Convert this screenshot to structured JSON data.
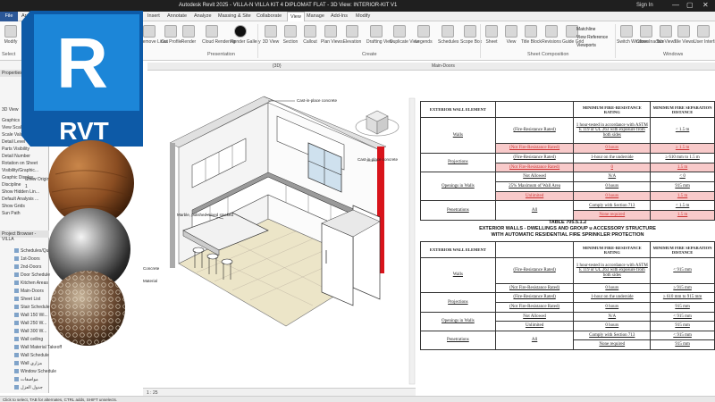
{
  "window": {
    "title": "Autodesk Revit 2025 - VILLA-N VILLA KIT 4 DIPLOMAT FLAT - 3D View: INTERIOR-KIT V1",
    "sign_in": "Sign In",
    "controls": [
      "—",
      "▢",
      "✕"
    ]
  },
  "menu": {
    "tabs": [
      "File",
      "Archi",
      "",
      "",
      "",
      "Insert",
      "Annotate",
      "Analyze",
      "Massing & Site",
      "Collaborate",
      "View",
      "Manage",
      "Add-Ins",
      "Modify"
    ],
    "active": "View"
  },
  "ribbon": {
    "buttons": [
      {
        "label": "Modify",
        "icon": "cursor-icon"
      },
      {
        "label": "Remove Lines",
        "icon": "remove-lines-icon"
      },
      {
        "label": "Cut Profile",
        "icon": "cut-profile-icon"
      },
      {
        "label": "Render",
        "icon": "teapot-icon"
      },
      {
        "label": "Cloud Rendering",
        "icon": "cloud-icon"
      },
      {
        "label": "Render Gallery",
        "icon": "gallery-icon"
      },
      {
        "label": "3D View",
        "icon": "cube-icon"
      },
      {
        "label": "Section",
        "icon": "section-icon"
      },
      {
        "label": "Callout",
        "icon": "callout-icon"
      },
      {
        "label": "Plan Views",
        "icon": "plan-icon"
      },
      {
        "label": "Elevation",
        "icon": "elevation-icon"
      },
      {
        "label": "Drafting View",
        "icon": "drafting-icon"
      },
      {
        "label": "Duplicate View",
        "icon": "duplicate-icon"
      },
      {
        "label": "Legends",
        "icon": "legend-icon"
      },
      {
        "label": "Schedules",
        "icon": "schedule-icon"
      },
      {
        "label": "Scope Box",
        "icon": "scope-icon"
      },
      {
        "label": "Sheet",
        "icon": "sheet-icon"
      },
      {
        "label": "View",
        "icon": "view-icon"
      },
      {
        "label": "Title Block",
        "icon": "titleblock-icon"
      },
      {
        "label": "Revisions",
        "icon": "revisions-icon"
      },
      {
        "label": "Guide Grid",
        "icon": "grid-icon"
      },
      {
        "label": "Switch Windows",
        "icon": "switch-icon"
      },
      {
        "label": "Close Inactive",
        "icon": "close-inactive-icon"
      },
      {
        "label": "Tab Views",
        "icon": "tab-icon"
      },
      {
        "label": "Tile Views",
        "icon": "tile-icon"
      },
      {
        "label": "User Interface",
        "icon": "ui-icon"
      }
    ],
    "groups": [
      "Select",
      "Presentation",
      "Create",
      "Sheet Composition",
      "Windows"
    ],
    "matchline": "Matchline",
    "view_reference": "View Reference",
    "viewports": "Viewports"
  },
  "doc_tabs": [
    "{3D}",
    "Main-Doors"
  ],
  "left_panel": {
    "properties_title": "Properties",
    "view_label": "3D View",
    "rows": [
      "Graphics",
      "View Scale",
      "Scale Value",
      "Detail Level",
      "Parts Visibility",
      "Detail Number",
      "Rotation on Sheet",
      "Visibility/Graphic...",
      "Graphic Display...",
      "Discipline",
      "Show Hidden Lin...",
      "Default Analysis ...",
      "Show Grids",
      "Sun Path",
      "Extents"
    ],
    "values": [
      "",
      "",
      "",
      "",
      "Show Origin",
      "1",
      "",
      "",
      "",
      "",
      "",
      "",
      "",
      "",
      ""
    ],
    "browser_title": "Project Browser - VILLA",
    "browser_items": [
      "Schedules/Quan...",
      "1st-Doors",
      "2nd-Doors",
      "Door Schedule",
      "Kitchen Areas",
      "Main-Doors",
      "Sheet List",
      "Stair Schedule",
      "Wall 150 Wi...",
      "Wall 250 W...",
      "Wall 300 W...",
      "Wall ceiling",
      "Wall Material Takeoff",
      "Wall Schedule",
      "Wall مزاري",
      "Window Schedule",
      "مواصفات",
      "جدول العزل",
      "Sheets (all)"
    ]
  },
  "logo": {
    "letter": "R",
    "text": "RVT",
    "color": "#1576c8"
  },
  "viewport": {
    "annotations": [
      "Cast-in-place concrete",
      "Cast-in-place concrete",
      "Marble, polished mixed stacked",
      "Concrete",
      "Material"
    ],
    "scale": "1 : 25"
  },
  "status": "Click to select, TAB for alternates, CTRL adds, SHIFT unselects.",
  "table1": {
    "headers": [
      "EXTERIOR WALL ELEMENT",
      "",
      "MINIMUM FIRE-RESISTANCE RATING",
      "MINIMUM FIRE SEPARATION DISTANCE"
    ],
    "rows": [
      [
        "Walls",
        "(Fire-Resistance Rated)",
        "1 hour-tested in accordance with ASTM E 119 or UL 263 with exposure from both sides",
        "< 1.5 m",
        false
      ],
      [
        "",
        "(Not Fire-Resistance Rated)",
        "0 hours",
        "≥ 1.5 m",
        true
      ],
      [
        "Projections",
        "(Fire-Resistance Rated)",
        "1-hour on the underside",
        "≥ 610 mm to 1.5 m",
        false
      ],
      [
        "",
        "(Not Fire-Resistance Rated)",
        "0",
        "1.5 m",
        true
      ],
      [
        "Openings in Walls",
        "Not Allowed",
        "N/A",
        "< 0",
        false
      ],
      [
        "",
        "25% Maximum of Wall Area",
        "0 hours",
        "915 mm",
        false
      ],
      [
        "",
        "Unlimited",
        "0 hours",
        "1.5 m",
        true
      ],
      [
        "Penetrations",
        "All",
        "Comply with Section 713",
        "< 1.5 m",
        false
      ],
      [
        "",
        "",
        "None required",
        "1.5 m",
        true
      ]
    ]
  },
  "table2": {
    "title": "TABLE 705.5.1.2",
    "subtitle1": "EXTERIOR WALLS - DWELLINGS AND GROUP u ACCESSORY STRUCTURE",
    "subtitle2": "WITH AUTOMATIC RESIDENTIAL FIRE SPRINKLER PROTECTION",
    "headers": [
      "EXTERIOR WALL ELEMENT",
      "",
      "MINIMUM FIRE-RESISTANCE RATING",
      "MINIMUM FIRE SEPARATION DISTANCE"
    ],
    "rows": [
      [
        "Walls",
        "(Fire-Resistance Rated)",
        "1 hour-tested in accordance with ASTM E 119 or UL 263 with exposure from both sides",
        "< 915 mm"
      ],
      [
        "",
        "(Not Fire-Resistance Rated)",
        "0 hours",
        "≥ 915 mm"
      ],
      [
        "Projections",
        "(Fire-Resistance Rated)",
        "1-hour on the underside",
        "≥ 610 mm to 915 mm"
      ],
      [
        "",
        "(Not Fire-Resistance Rated)",
        "0 hours",
        "915 mm"
      ],
      [
        "Openings in Walls",
        "Not Allowed",
        "N/A",
        "< 915 mm"
      ],
      [
        "",
        "Unlimited",
        "0 hours",
        "915 mm"
      ],
      [
        "Penetrations",
        "All",
        "Comply with Section 713",
        "< 915 mm"
      ],
      [
        "",
        "",
        "None required",
        "915 mm"
      ]
    ]
  }
}
